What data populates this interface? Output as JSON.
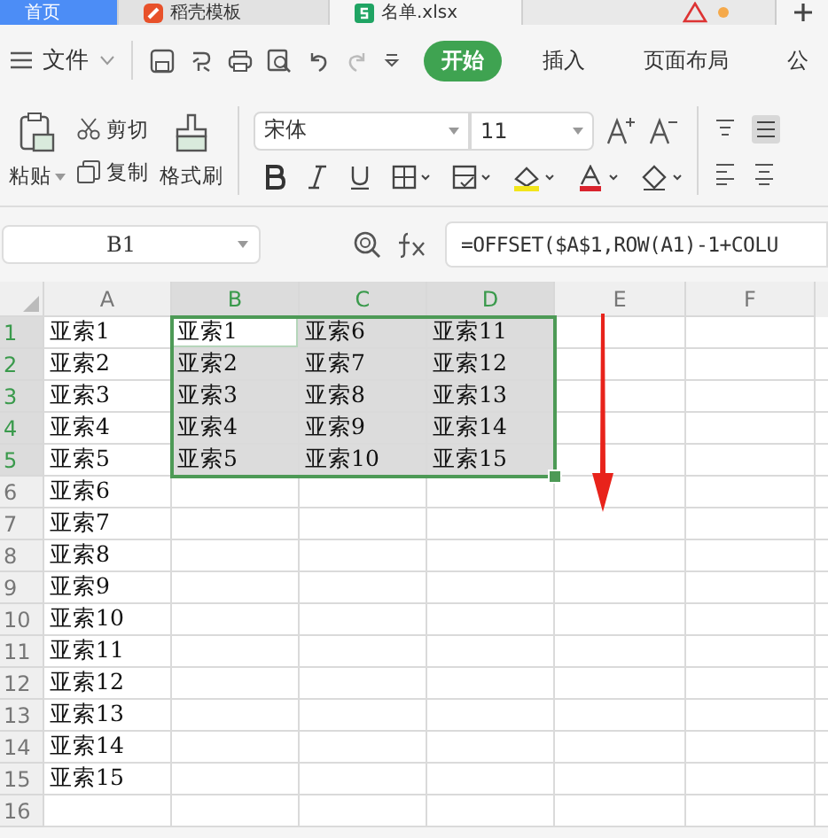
{
  "tabs": [
    {
      "label": "首页",
      "kind": "home",
      "selected": false
    },
    {
      "label": "稻壳模板",
      "kind": "template",
      "selected": false
    },
    {
      "label": "名单.xlsx",
      "kind": "sheet",
      "selected": true
    }
  ],
  "menu": {
    "file": "文件",
    "ribbon_tabs": [
      {
        "label": "开始",
        "selected": true
      },
      {
        "label": "插入",
        "selected": false
      },
      {
        "label": "页面布局",
        "selected": false
      },
      {
        "label": "公",
        "selected": false
      }
    ]
  },
  "ribbon": {
    "paste": "粘贴",
    "cut": "剪切",
    "copy": "复制",
    "format_painter": "格式刷",
    "font": "宋体",
    "size": "11"
  },
  "name_box": "B1",
  "formula": "=OFFSET($A$1,ROW(A1)-1+COLU",
  "columns": [
    {
      "label": "A",
      "selected": false
    },
    {
      "label": "B",
      "selected": true
    },
    {
      "label": "C",
      "selected": true
    },
    {
      "label": "D",
      "selected": true
    },
    {
      "label": "E",
      "selected": false
    },
    {
      "label": "F",
      "selected": false
    }
  ],
  "rows": [
    {
      "number": "1",
      "selected": true,
      "cells": [
        {
          "text": "亚索1",
          "active": false
        },
        {
          "text": "亚索1",
          "active": true
        },
        {
          "text": "亚索6",
          "active": false
        },
        {
          "text": "亚索11",
          "active": false
        }
      ]
    },
    {
      "number": "2",
      "selected": true,
      "cells": [
        {
          "text": "亚索2",
          "active": false
        },
        {
          "text": "亚索2",
          "active": false
        },
        {
          "text": "亚索7",
          "active": false
        },
        {
          "text": "亚索12",
          "active": false
        }
      ]
    },
    {
      "number": "3",
      "selected": true,
      "cells": [
        {
          "text": "亚索3",
          "active": false
        },
        {
          "text": "亚索3",
          "active": false
        },
        {
          "text": "亚索8",
          "active": false
        },
        {
          "text": "亚索13",
          "active": false
        }
      ]
    },
    {
      "number": "4",
      "selected": true,
      "cells": [
        {
          "text": "亚索4",
          "active": false
        },
        {
          "text": "亚索4",
          "active": false
        },
        {
          "text": "亚索9",
          "active": false
        },
        {
          "text": "亚索14",
          "active": false
        }
      ]
    },
    {
      "number": "5",
      "selected": true,
      "cells": [
        {
          "text": "亚索5",
          "active": false
        },
        {
          "text": "亚索5",
          "active": false
        },
        {
          "text": "亚索10",
          "active": false
        },
        {
          "text": "亚索15",
          "active": false
        }
      ]
    },
    {
      "number": "6",
      "selected": false,
      "cells": [
        {
          "text": "亚索6",
          "active": false
        }
      ]
    },
    {
      "number": "7",
      "selected": false,
      "cells": [
        {
          "text": "亚索7",
          "active": false
        }
      ]
    },
    {
      "number": "8",
      "selected": false,
      "cells": [
        {
          "text": "亚索8",
          "active": false
        }
      ]
    },
    {
      "number": "9",
      "selected": false,
      "cells": [
        {
          "text": "亚索9",
          "active": false
        }
      ]
    },
    {
      "number": "10",
      "selected": false,
      "cells": [
        {
          "text": "亚索10",
          "active": false
        }
      ]
    },
    {
      "number": "11",
      "selected": false,
      "cells": [
        {
          "text": "亚索11",
          "active": false
        }
      ]
    },
    {
      "number": "12",
      "selected": false,
      "cells": [
        {
          "text": "亚索12",
          "active": false
        }
      ]
    },
    {
      "number": "13",
      "selected": false,
      "cells": [
        {
          "text": "亚索13",
          "active": false
        }
      ]
    },
    {
      "number": "14",
      "selected": false,
      "cells": [
        {
          "text": "亚索14",
          "active": false
        }
      ]
    },
    {
      "number": "15",
      "selected": false,
      "cells": [
        {
          "text": "亚索15",
          "active": false
        }
      ]
    },
    {
      "number": "16",
      "selected": false
    }
  ]
}
